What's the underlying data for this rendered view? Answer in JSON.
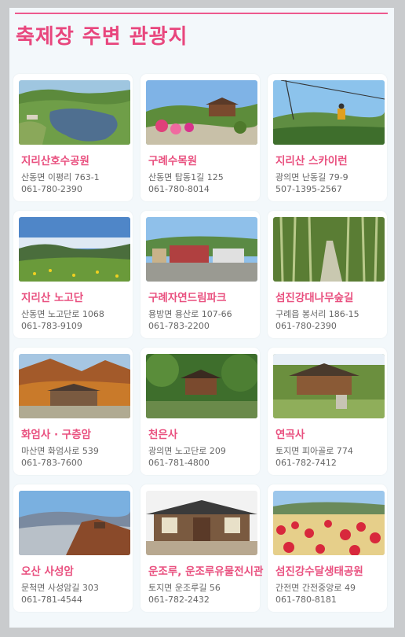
{
  "page": {
    "title": "축제장 주변 관광지",
    "accent": "#e8467d"
  },
  "places": [
    {
      "name": "지리산호수공원",
      "address": "산동면 이평리 763-1",
      "phone": "061-780-2390",
      "photo": "lake-park-photo"
    },
    {
      "name": "구례수목원",
      "address": "산동면 탑동1길 125",
      "phone": "061-780-8014",
      "photo": "arboretum-photo"
    },
    {
      "name": "지리산 스카이런",
      "address": "광의면 난동길 79-9",
      "phone": "507-1395-2567",
      "photo": "zipline-photo"
    },
    {
      "name": "지리산 노고단",
      "address": "산동면 노고단로 1068",
      "phone": "061-783-9109",
      "photo": "nogodan-photo"
    },
    {
      "name": "구례자연드림파크",
      "address": "용방면 용산로 107-66",
      "phone": "061-783-2200",
      "photo": "dream-park-photo"
    },
    {
      "name": "섬진강대나무숲길",
      "address": "구례읍 봉서리 186-15",
      "phone": "061-780-2390",
      "photo": "bamboo-forest-photo"
    },
    {
      "name": "화엄사 · 구층암",
      "address": "마산면 화엄사로 539",
      "phone": "061-783-7600",
      "photo": "hwaeomsa-photo"
    },
    {
      "name": "천은사",
      "address": "광의면 노고단로 209",
      "phone": "061-781-4800",
      "photo": "cheoneunsa-photo"
    },
    {
      "name": "연곡사",
      "address": "토지면 피아골로 774",
      "phone": "061-782-7412",
      "photo": "yeongoksa-photo"
    },
    {
      "name": "오산 사성암",
      "address": "문척면 사성암길 303",
      "phone": "061-781-4544",
      "photo": "saseongam-photo"
    },
    {
      "name": "운조루, 운조루유물전시관",
      "address": "토지면 운조루길 56",
      "phone": "061-782-2432",
      "photo": "unjoru-photo"
    },
    {
      "name": "섬진강수달생태공원",
      "address": "간전면 간전중앙로 49",
      "phone": "061-780-8181",
      "photo": "otter-park-photo"
    }
  ]
}
